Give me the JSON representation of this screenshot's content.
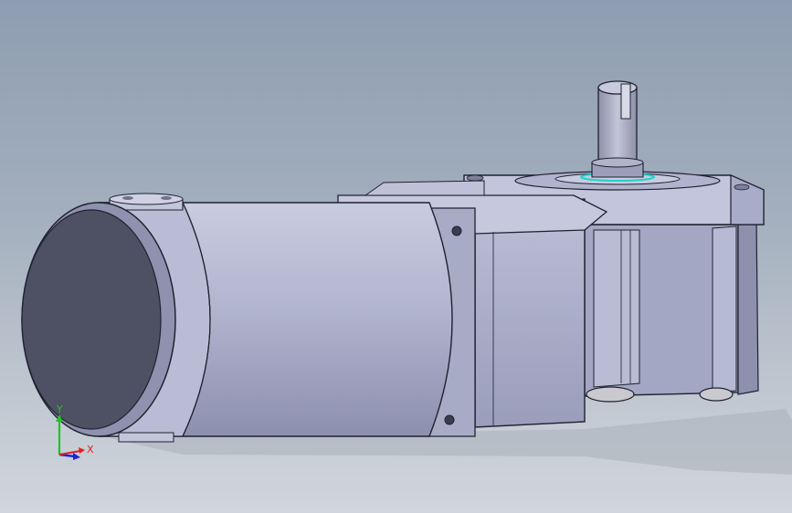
{
  "viewport": {
    "background_top": "#8e9db1",
    "background_bottom": "#d1d6dc"
  },
  "model": {
    "body_color": "#b5b8d1",
    "edge_color": "#1f2230",
    "accent_color": "#1fd2c8"
  },
  "triad": {
    "y_label": "Y",
    "x_label": "X",
    "y_color": "#22c322",
    "x_color": "#e02020",
    "z_color": "#2323d8"
  }
}
